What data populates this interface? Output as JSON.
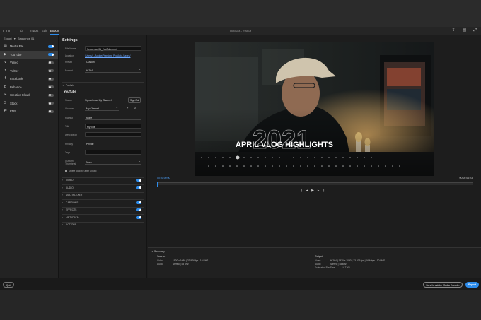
{
  "window": {
    "title": "Untitled - Edited"
  },
  "tabs": [
    "Import",
    "Edit",
    "Export"
  ],
  "left_panel": {
    "header": "Export",
    "sequence": "Sequence 01",
    "destinations": [
      {
        "label": "Media File",
        "icon": "media-file-icon",
        "on": true
      },
      {
        "label": "YouTube",
        "icon": "youtube-icon",
        "on": true,
        "selected": true
      },
      {
        "label": "Vimeo",
        "icon": "vimeo-icon",
        "on": false
      },
      {
        "label": "Twitter",
        "icon": "twitter-icon",
        "on": false
      },
      {
        "label": "Facebook",
        "icon": "facebook-icon",
        "on": false
      },
      {
        "label": "Behance",
        "icon": "behance-icon",
        "on": false
      },
      {
        "label": "Creative Cloud",
        "icon": "creative-cloud-icon",
        "on": false
      },
      {
        "label": "Stock",
        "icon": "stock-icon",
        "on": false
      },
      {
        "label": "FTP",
        "icon": "ftp-icon",
        "on": false
      }
    ]
  },
  "settings": {
    "title": "Settings",
    "file_name_label": "File Name",
    "file_name": "Sequence 01_YouTube.mp4",
    "location_label": "Location",
    "location": "/Users/.../Adobe/Premiere Pro Auto-Saves/",
    "preset_label": "Preset",
    "preset": "Custom",
    "format_label": "Format",
    "format": "H.264",
    "publish_label": "Publish",
    "youtube_label": "YouTube",
    "status_label": "Status",
    "status": "Signed in as My Channel",
    "sign_out": "Sign Out",
    "channel_label": "Channel",
    "channel": "My Channel",
    "playlist_label": "Playlist",
    "playlist": "None",
    "title_label": "Title",
    "title_value": "My Title",
    "description_label": "Description",
    "privacy_label": "Privacy",
    "privacy": "Private",
    "tags_label": "Tags",
    "thumbnail_label": "Custom Thumbnail",
    "thumbnail": "None",
    "delete_label": "Delete local file after upload",
    "sections": [
      {
        "label": "VIDEO",
        "toggle": true
      },
      {
        "label": "AUDIO",
        "toggle": true
      },
      {
        "label": "MULTIPLEXER",
        "toggle": null
      },
      {
        "label": "CAPTIONS",
        "toggle": true
      },
      {
        "label": "EFFECTS",
        "toggle": true
      },
      {
        "label": "METADATA",
        "toggle": true
      },
      {
        "label": "ACTIONS",
        "toggle": null
      }
    ]
  },
  "preview": {
    "overlay_year": "2021",
    "overlay_title": "APRIL VLOG HIGHLIGHTS",
    "timecode_start": "00;00;00;00",
    "timecode_end": "00;00;06;23"
  },
  "summary": {
    "title": "Summary",
    "source": {
      "heading": "Source",
      "video_label": "Video",
      "video": "1920 x 1080 | 23.976 fps | 10 PHS",
      "audio_label": "Audio",
      "audio": "Stereo | 48 kHz"
    },
    "output": {
      "heading": "Output",
      "video_label": "Video",
      "video": "H.264 | 1920 x 1080 | 23.976 fps | 16 Mbps | 10 PHS",
      "audio_label": "Audio",
      "audio": "Stereo | 48 kHz",
      "size_label": "Estimated File Size",
      "size": "14.7 KB"
    }
  },
  "footer": {
    "queue": "Quit",
    "send_to_ame": "Send to Adobe Media Encoder",
    "export": "Export"
  },
  "colors": {
    "accent": "#2d8ceb",
    "panel": "#1f1f1f"
  }
}
